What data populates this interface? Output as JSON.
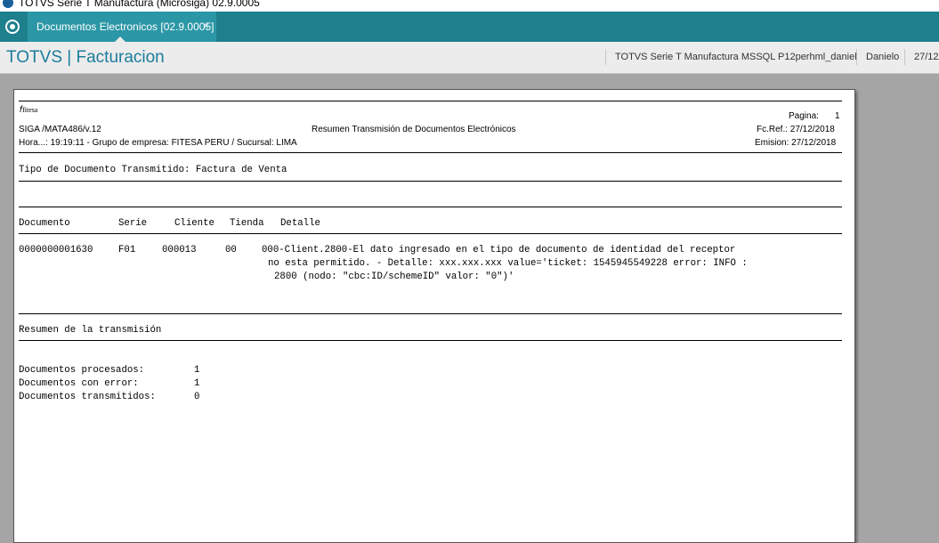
{
  "window": {
    "title": "TOTVS Serie T Manufactura (Microsiga) 02.9.0005"
  },
  "tab": {
    "label": "Documentos Electronicos [02.9.0005]",
    "close": "×"
  },
  "header": {
    "app_title": "TOTVS | Facturacion",
    "environment": "TOTVS Serie T Manufactura MSSQL P12perhml_daniel",
    "user": "Danielo",
    "date": "27/12/"
  },
  "report": {
    "logo_text": "fitesa",
    "pagina_label": "Pagina:",
    "pagina_value": "1",
    "program": "SIGA /MATA486/v.12",
    "title": "Resumen Transmisión de Documentos Electrónicos",
    "fc_ref": "Fc.Ref.: 27/12/2018",
    "hora": "Hora...: 19:19:11 - Grupo de empresa: FITESA PERU / Sucursal: LIMA",
    "emision": "Emision: 27/12/2018",
    "tipo_documento": "Tipo de Documento Transmitido: Factura de Venta",
    "columns": [
      "Documento",
      "Serie",
      "Cliente",
      "Tienda",
      "Detalle"
    ],
    "rows": [
      {
        "documento": "0000000001630",
        "serie": "F01",
        "cliente": "000013",
        "tienda": "00",
        "detalle": [
          "000-Client.2800-El dato ingresado en el tipo de documento de identidad del receptor",
          "no esta permitido. - Detalle: xxx.xxx.xxx value='ticket: 1545945549228 error: INFO :",
          "2800 (nodo: \"cbc:ID/schemeID\" valor: \"0\")'"
        ]
      }
    ],
    "resumen_title": "Resumen de la transmisión",
    "summary": [
      {
        "label": "Documentos procesados:",
        "value": "1"
      },
      {
        "label": "Documentos con error:",
        "value": "1"
      },
      {
        "label": "Documentos transmitidos:",
        "value": "0"
      }
    ]
  }
}
